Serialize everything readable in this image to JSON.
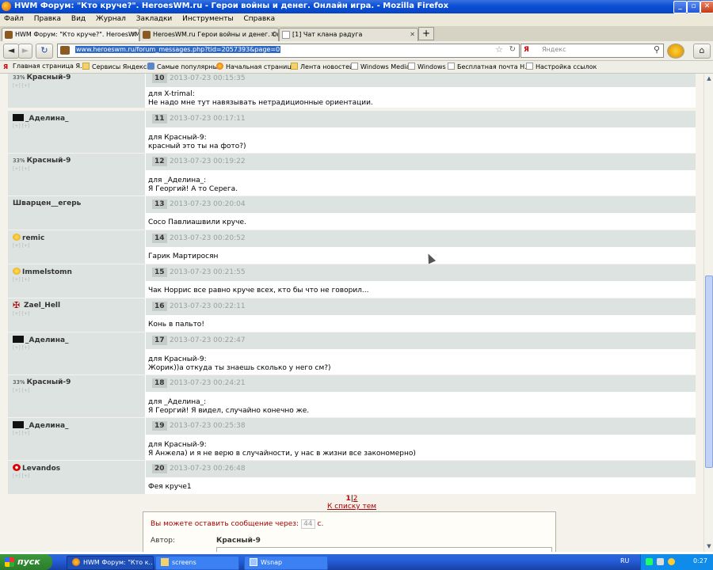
{
  "window": {
    "title": "HWM Форум: \"Кто круче?\". HeroesWM.ru - Герои войны и денег. Онлайн игра. - Mozilla Firefox",
    "minimize": "_",
    "maximize": "▫",
    "close": "✕"
  },
  "menu": [
    "Файл",
    "Правка",
    "Вид",
    "Журнал",
    "Закладки",
    "Инструменты",
    "Справка"
  ],
  "tabs": [
    {
      "label": "HWM Форум: \"Кто круче?\". HeroesWM....",
      "close": "✕"
    },
    {
      "label": "HeroesWM.ru Герои войны и денег. Он...",
      "close": "✕"
    },
    {
      "label": "[1] Чат клана радуга",
      "close": "✕"
    }
  ],
  "new_tab": "+",
  "nav": {
    "back": "◄",
    "forward": "►",
    "url": "www.heroeswm.ru/forum_messages.php?tid=2057393&page=0",
    "search_placeholder": "Яндекс",
    "home": "⌂",
    "reload": "↻",
    "bookmark_star": "☆",
    "search_icon": "⚲"
  },
  "bookmarks": [
    "Главная страница Я...",
    "Сервисы Яндекса",
    "Самые популярные",
    "Начальная страница",
    "Лента новостей",
    "Windows Media",
    "Windows",
    "Бесплатная почта Н...",
    "Настройка ссылок"
  ],
  "posts": [
    {
      "author": "Красный-9",
      "icon": "percent-icon",
      "icon_text": "33%",
      "stats": "[+] [+]",
      "num": "10",
      "date": "2013-07-23 00:15:35",
      "lines": [
        "для X-trimal:",
        "Не надо мне тут навязывать нетрадиционные ориентации."
      ]
    },
    {
      "author": "_Аделина_",
      "icon": "black-flag-icon",
      "icon_text": "",
      "stats": "[+] [+]",
      "num": "11",
      "date": "2013-07-23 00:17:11",
      "lines": [
        "для Красный-9:",
        "красный это ты на фото?)"
      ]
    },
    {
      "author": "Красный-9",
      "icon": "percent-icon",
      "icon_text": "33%",
      "stats": "[+] [+]",
      "num": "12",
      "date": "2013-07-23 00:19:22",
      "lines": [
        "для _Аделина_:",
        "Я Георгий! А то Серега."
      ]
    },
    {
      "author": "Шварцен__егерь",
      "icon": "",
      "icon_text": "",
      "stats": "",
      "num": "13",
      "date": "2013-07-23 00:20:04",
      "lines": [
        "Сосо Павлиашвили круче."
      ]
    },
    {
      "author": "remic",
      "icon": "smiley-icon",
      "icon_text": "",
      "stats": "[+] [+]",
      "num": "14",
      "date": "2013-07-23 00:20:52",
      "lines": [
        "Гарик Мартиросян"
      ]
    },
    {
      "author": "Immelstomn",
      "icon": "smiley-icon",
      "icon_text": "",
      "stats": "[+] [+]",
      "num": "15",
      "date": "2013-07-23 00:21:55",
      "lines": [
        "Чак Норрис все равно круче всех, кто бы что не говорил..."
      ]
    },
    {
      "author": "Zael_Hell",
      "icon": "cross-icon",
      "icon_text": "",
      "stats": "[+] [+]",
      "num": "16",
      "date": "2013-07-23 00:22:11",
      "lines": [
        "Конь в пальто!"
      ]
    },
    {
      "author": "_Аделина_",
      "icon": "black-flag-icon",
      "icon_text": "",
      "stats": "[+] [+]",
      "num": "17",
      "date": "2013-07-23 00:22:47",
      "lines": [
        "для Красный-9:",
        "Жорик))а откуда ты знаешь сколько у него см?)"
      ]
    },
    {
      "author": "Красный-9",
      "icon": "percent-icon",
      "icon_text": "33%",
      "stats": "[+] [+]",
      "num": "18",
      "date": "2013-07-23 00:24:21",
      "lines": [
        "для _Аделина_:",
        "Я Георгий! Я видел, случайно конечно же."
      ]
    },
    {
      "author": "_Аделина_",
      "icon": "black-flag-icon",
      "icon_text": "",
      "stats": "[+] [+]",
      "num": "19",
      "date": "2013-07-23 00:25:38",
      "lines": [
        "для Красный-9:",
        "Я Анжела) и я не верю в случайности, у нас в жизни все закономерно)"
      ]
    },
    {
      "author": "Levandos",
      "icon": "red-emblem-icon",
      "icon_text": "",
      "stats": "[+] [+]",
      "num": "20",
      "date": "2013-07-23 00:26:48",
      "lines": [
        "Фея круче1"
      ]
    }
  ],
  "pager": {
    "current": "1",
    "separator": "|",
    "next": "2",
    "back_link": "К списку тем"
  },
  "reply": {
    "notice_before": "Вы можете оставить сообщение через:",
    "seconds": "44",
    "notice_after": "с.",
    "author_label": "Автор:",
    "author_name": "Красный-9"
  },
  "taskbar": {
    "start": "пуск",
    "tasks": [
      "HWM Форум: \"Кто к...",
      "screens",
      "Wsnap"
    ],
    "lang": "RU",
    "clock": "0:27"
  },
  "colors": {
    "post_header_bg": "#dde3e0",
    "title_blue": "#0a4fd6",
    "link_red": "#aa0000"
  }
}
